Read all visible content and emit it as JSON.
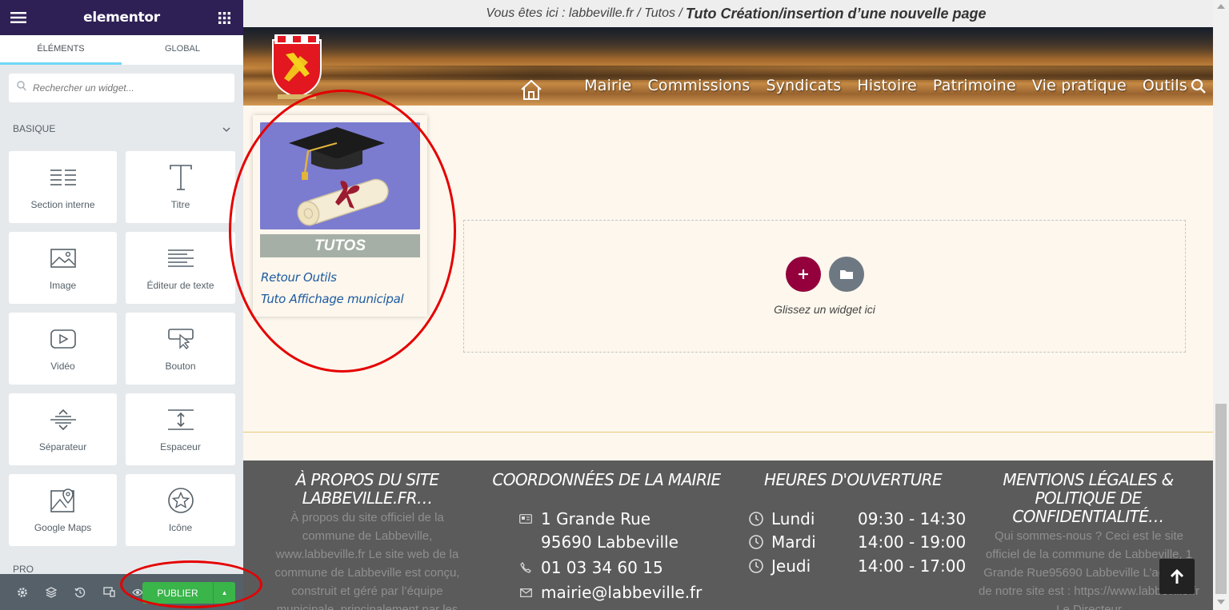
{
  "panel": {
    "brand": "elementor",
    "tabs": [
      {
        "label": "ÉLÉMENTS",
        "active": true
      },
      {
        "label": "GLOBAL",
        "active": false
      }
    ],
    "search": {
      "placeholder": "Rechercher un widget..."
    },
    "category": "BASIQUE",
    "widgets": [
      {
        "label": "Section interne",
        "icon": "inner-section-icon"
      },
      {
        "label": "Titre",
        "icon": "heading-icon"
      },
      {
        "label": "Image",
        "icon": "image-icon"
      },
      {
        "label": "Éditeur de texte",
        "icon": "text-editor-icon"
      },
      {
        "label": "Vidéo",
        "icon": "video-icon"
      },
      {
        "label": "Bouton",
        "icon": "button-icon"
      },
      {
        "label": "Séparateur",
        "icon": "divider-icon"
      },
      {
        "label": "Espaceur",
        "icon": "spacer-icon"
      },
      {
        "label": "Google Maps",
        "icon": "google-maps-icon"
      },
      {
        "label": "Icône",
        "icon": "star-icon"
      }
    ],
    "pro_label": "PRO",
    "footer": {
      "publish_label": "PUBLIER",
      "icons": [
        "settings-icon",
        "navigator-icon",
        "history-icon",
        "responsive-icon",
        "preview-icon"
      ]
    }
  },
  "preview": {
    "breadcrumb": {
      "prefix": "Vous êtes ici : labbeville.fr / Tutos /",
      "current": "Tuto Création/insertion d’une nouvelle page"
    },
    "nav": [
      "Mairie",
      "Commissions",
      "Syndicats",
      "Histoire",
      "Patrimoine",
      "Vie pratique",
      "Outils"
    ],
    "tuto_card": {
      "title": "TUTOS",
      "links": [
        "Retour Outils",
        "Tuto Affichage municipal"
      ]
    },
    "drop_zone": {
      "text": "Glissez un widget ici"
    },
    "footer": {
      "about": {
        "title": "À PROPOS DU SITE LABBEVILLE.FR…",
        "text": "À propos du site officiel de la commune de Labbeville, www.labbeville.fr Le site web de la commune de Labbeville est conçu, construit et géré par l’équipe municipale, principalement par les"
      },
      "contact": {
        "title": "COORDONNÉES DE LA MAIRIE",
        "address_line1": "1 Grande Rue",
        "address_line2": "95690 Labbeville",
        "phone": "01 03 34 60 15",
        "email": "mairie@labbeville.fr"
      },
      "hours": {
        "title": "HEURES D'OUVERTURE",
        "rows": [
          {
            "day": "Lundi",
            "time": "09:30 - 14:30"
          },
          {
            "day": "Mardi",
            "time": "14:00 - 19:00"
          },
          {
            "day": "Jeudi",
            "time": "14:00 - 17:00"
          }
        ]
      },
      "legal": {
        "title": "MENTIONS LÉGALES & POLITIQUE DE CONFIDENTIALITÉ…",
        "text": "Qui sommes-nous ? Ceci est le site officiel de la commune de Labbeville, 1 Grande Rue95690 Labbeville L’adresse de notre site est : https://www.labbeville.fr Le Directeur"
      }
    }
  },
  "colors": {
    "panel_header": "#2e2055",
    "publish": "#39b54a",
    "add_section": "#93003c",
    "footer_bg": "#5b5b5b",
    "annotation": "#e50000"
  }
}
